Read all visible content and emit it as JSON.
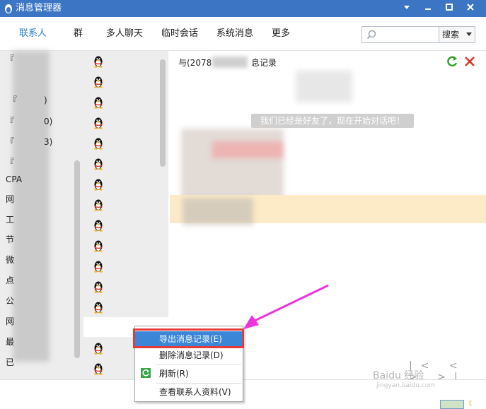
{
  "window": {
    "title": "消息管理器",
    "icons": [
      "penguin-icon",
      "chevron-down-icon",
      "minimize-icon",
      "maximize-icon",
      "close-icon"
    ]
  },
  "nav": {
    "tabs": [
      {
        "label": "联系人",
        "active": true
      },
      {
        "label": "群",
        "active": false
      },
      {
        "label": "多人聊天",
        "active": false
      },
      {
        "label": "临时会话",
        "active": false
      },
      {
        "label": "系统消息",
        "active": false
      },
      {
        "label": "更多",
        "active": false
      }
    ],
    "search_placeholder": "",
    "search_button": "搜索"
  },
  "groups": {
    "items": [
      "『",
      "『",
      "『",
      "『",
      "『",
      "CPA",
      "网",
      "工",
      "节",
      "微",
      "点",
      "公",
      "网",
      "最",
      "已"
    ],
    "partial_texts": [
      ")",
      "0)",
      "3)"
    ]
  },
  "contacts": {
    "avatar_icon": "penguin-icon",
    "count": 16
  },
  "message": {
    "header_prefix": "与(2078",
    "header_suffix": "息记录",
    "system_notice": "我们已经是好友了，现在开始对话吧！",
    "pager_glyphs": "|< < > >|"
  },
  "context_menu": {
    "items": [
      {
        "label": "导出消息记录(E)",
        "active": true
      },
      {
        "label": "删除消息记录(D)",
        "active": false
      },
      {
        "label": "刷新(R)",
        "active": false,
        "icon": "refresh-icon"
      },
      {
        "label": "查看联系人资料(V)",
        "active": false
      }
    ]
  },
  "watermark": {
    "line1": "Baidu 经验",
    "line2": "jingyan.baidu.com"
  },
  "colors": {
    "titlebar": "#3b75c4",
    "active_tab": "#2c7bd1",
    "menu_active": "#3b86d6",
    "highlight_frame": "#e93a3a",
    "arrow": "#ee33dd",
    "selected_row": "#fdebc7"
  }
}
